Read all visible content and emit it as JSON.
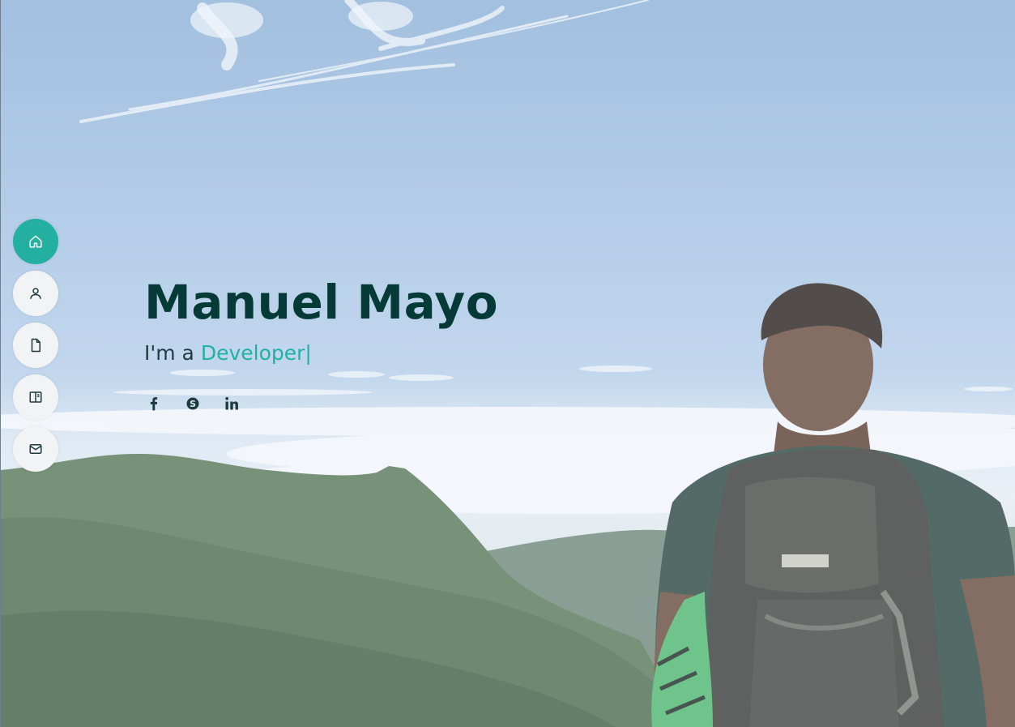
{
  "hero": {
    "name": "Manuel Mayo",
    "tagline_prefix": "I'm a ",
    "tagline_role": "Developer",
    "cursor": "|"
  },
  "nav": {
    "items": [
      {
        "label": "Home",
        "icon": "home-icon",
        "active": true
      },
      {
        "label": "About",
        "icon": "user-icon",
        "active": false
      },
      {
        "label": "Resume",
        "icon": "file-icon",
        "active": false
      },
      {
        "label": "Portfolio",
        "icon": "book-icon",
        "active": false
      },
      {
        "label": "Contact",
        "icon": "mail-icon",
        "active": false
      }
    ]
  },
  "social": [
    {
      "name": "Facebook",
      "icon": "facebook-icon"
    },
    {
      "name": "Skype",
      "icon": "skype-icon"
    },
    {
      "name": "LinkedIn",
      "icon": "linkedin-icon"
    }
  ],
  "colors": {
    "accent": "#23b0a0",
    "name_text": "#063a36",
    "nav_bg": "#f2f3f5"
  }
}
